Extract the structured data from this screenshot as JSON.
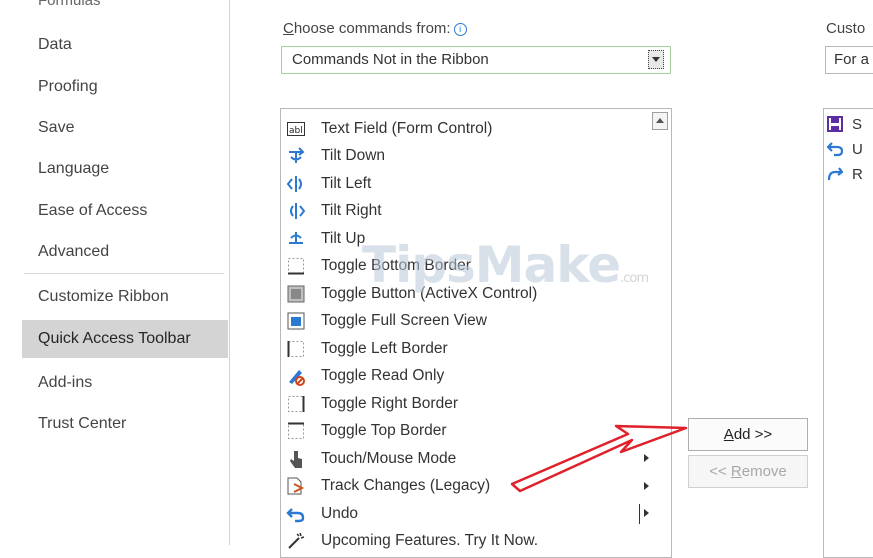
{
  "nav": {
    "partial_top": "Formulas",
    "items": [
      {
        "label": "Data"
      },
      {
        "label": "Proofing"
      },
      {
        "label": "Save"
      },
      {
        "label": "Language"
      },
      {
        "label": "Ease of Access"
      },
      {
        "label": "Advanced"
      },
      {
        "label": "Customize Ribbon"
      },
      {
        "label": "Quick Access Toolbar",
        "selected": true
      },
      {
        "label": "Add-ins"
      },
      {
        "label": "Trust Center"
      }
    ]
  },
  "commands": {
    "label_key": "C",
    "label_rest": "hoose commands from:",
    "info": "i",
    "dropdown_value": "Commands Not in the Ribbon",
    "items": [
      {
        "label": "Text Field (Form Control)",
        "icon": "text-field-icon"
      },
      {
        "label": "Tilt Down",
        "icon": "tilt-down-icon"
      },
      {
        "label": "Tilt Left",
        "icon": "tilt-left-icon"
      },
      {
        "label": "Tilt Right",
        "icon": "tilt-right-icon"
      },
      {
        "label": "Tilt Up",
        "icon": "tilt-up-icon"
      },
      {
        "label": "Toggle Bottom Border",
        "icon": "bottom-border-icon"
      },
      {
        "label": "Toggle Button (ActiveX Control)",
        "icon": "toggle-button-icon"
      },
      {
        "label": "Toggle Full Screen View",
        "icon": "full-screen-icon"
      },
      {
        "label": "Toggle Left Border",
        "icon": "left-border-icon"
      },
      {
        "label": "Toggle Read Only",
        "icon": "read-only-icon"
      },
      {
        "label": "Toggle Right Border",
        "icon": "right-border-icon"
      },
      {
        "label": "Toggle Top Border",
        "icon": "top-border-icon"
      },
      {
        "label": "Touch/Mouse Mode",
        "icon": "touch-mode-icon",
        "submenu": true
      },
      {
        "label": "Track Changes (Legacy)",
        "icon": "track-changes-icon",
        "submenu": true
      },
      {
        "label": "Undo",
        "icon": "undo-icon",
        "split": true
      },
      {
        "label": "Upcoming Features. Try It Now.",
        "icon": "upcoming-features-icon"
      }
    ]
  },
  "customize": {
    "label": "Custo",
    "dropdown_value": "For a",
    "items": [
      {
        "label": "S",
        "icon": "save-icon"
      },
      {
        "label": "U",
        "icon": "undo-icon"
      },
      {
        "label": "R",
        "icon": "redo-icon"
      }
    ]
  },
  "buttons": {
    "add_key": "A",
    "add_rest": "dd >>",
    "remove_prefix": "<< ",
    "remove_key": "R",
    "remove_rest": "emove"
  },
  "watermark": {
    "text": "TipsMake",
    "suffix": ".com"
  },
  "colors": {
    "selected_bg": "#d4d4d4",
    "arrow": "#e0202a",
    "dropdown_border": "#a8cf9c",
    "icon_blue": "#2b79d0"
  }
}
